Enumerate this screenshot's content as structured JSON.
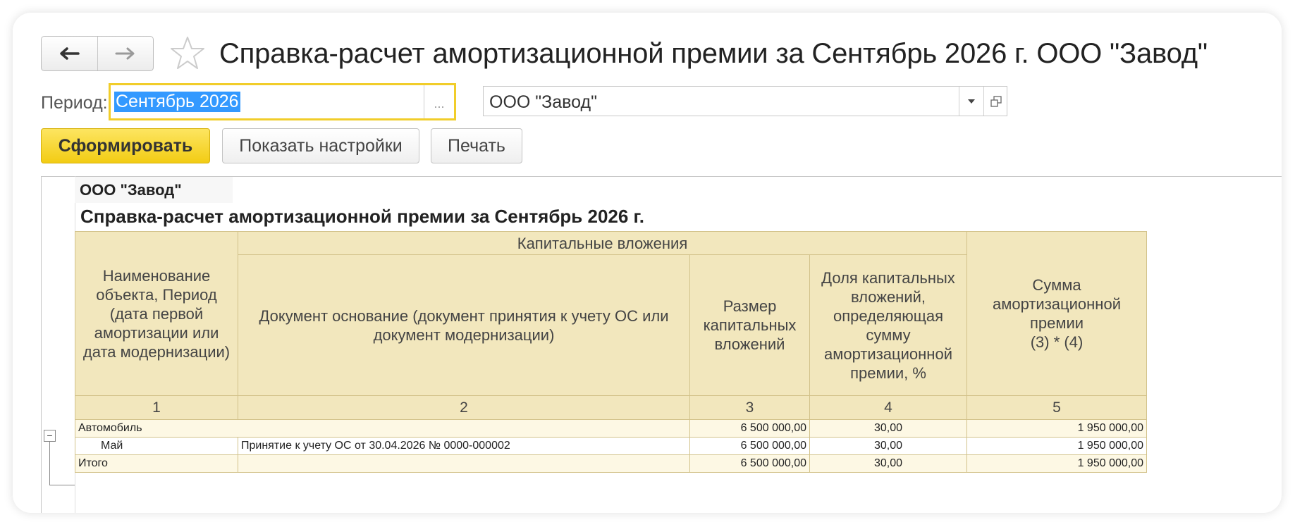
{
  "window": {
    "title": "Справка-расчет амортизационной премии  за Сентябрь 2026 г. ООО \"Завод\""
  },
  "filters": {
    "period_label": "Период:",
    "period_value": "Сентябрь 2026",
    "period_select": "...",
    "organization": "ООО \"Завод\""
  },
  "toolbar": {
    "generate": "Сформировать",
    "show_settings": "Показать настройки",
    "print": "Печать"
  },
  "report": {
    "organization": "ООО \"Завод\"",
    "title": "Справка-расчет амортизационной премии  за Сентябрь 2026 г.",
    "headers": {
      "name": "Наименование объекта, Период (дата первой амортизации или дата модернизации)",
      "capital_group": "Капитальные вложения",
      "document": "Документ основание (документ принятия к учету ОС или документ модернизации)",
      "size": "Размер капитальных вложений",
      "share": "Доля капитальных вложений, определяющая сумму амортизационной премии, %",
      "sum": "Сумма амортизационной премии",
      "sum_formula": "(3) * (4)"
    },
    "column_numbers": [
      "1",
      "2",
      "3",
      "4",
      "5"
    ],
    "group_row": {
      "name": "Автомобиль",
      "document": "",
      "size": "6 500 000,00",
      "share": "30,00",
      "sum": "1 950 000,00"
    },
    "detail_row": {
      "name": "Май",
      "document": "Принятие к учету ОС от 30.04.2026 № 0000-000002",
      "size": "6 500 000,00",
      "share": "30,00",
      "sum": "1 950 000,00"
    },
    "total_row": {
      "name": "Итого",
      "document": "",
      "size": "6 500 000,00",
      "share": "30,00",
      "sum": "1 950 000,00"
    },
    "collapse_symbol": "−"
  }
}
